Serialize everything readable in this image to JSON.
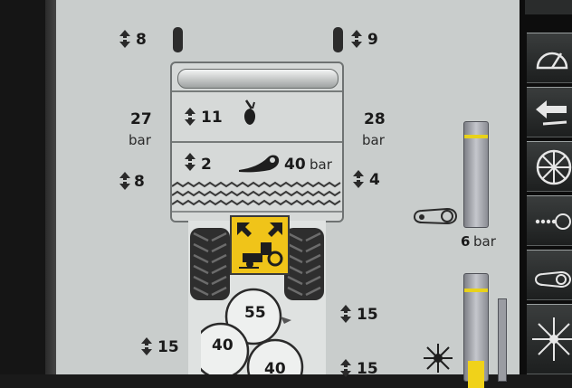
{
  "lift_indicators": {
    "top_left": "8",
    "top_right": "9",
    "mid_left": "8",
    "mid_right": "4",
    "unit1": "11",
    "unit2": "2"
  },
  "pressures": {
    "left_value": "27",
    "left_unit": "bar",
    "right_value": "28",
    "right_unit": "bar",
    "packer_value": "40",
    "packer_unit": "bar",
    "drive_value": "6",
    "drive_unit": "bar"
  },
  "wheels": {
    "top": "55",
    "left": "40",
    "bottom": "40"
  },
  "side_values": {
    "right_upper": "15",
    "left_lower": "15",
    "right_lower": "15"
  },
  "colors": {
    "panel_bg": "#c9cdcc",
    "accent_yellow": "#f0c419",
    "meter_mark": "#e8d21a",
    "toolbar_bg": "#0d0d0d"
  },
  "icons": {
    "lift": "double-arrow-lift-icon",
    "seed": "seed-drop-icon",
    "packer": "packer-roller-icon",
    "tractor": "tractor-mode-icon",
    "chain": "chain-drive-icon",
    "fan": "fan-icon"
  }
}
